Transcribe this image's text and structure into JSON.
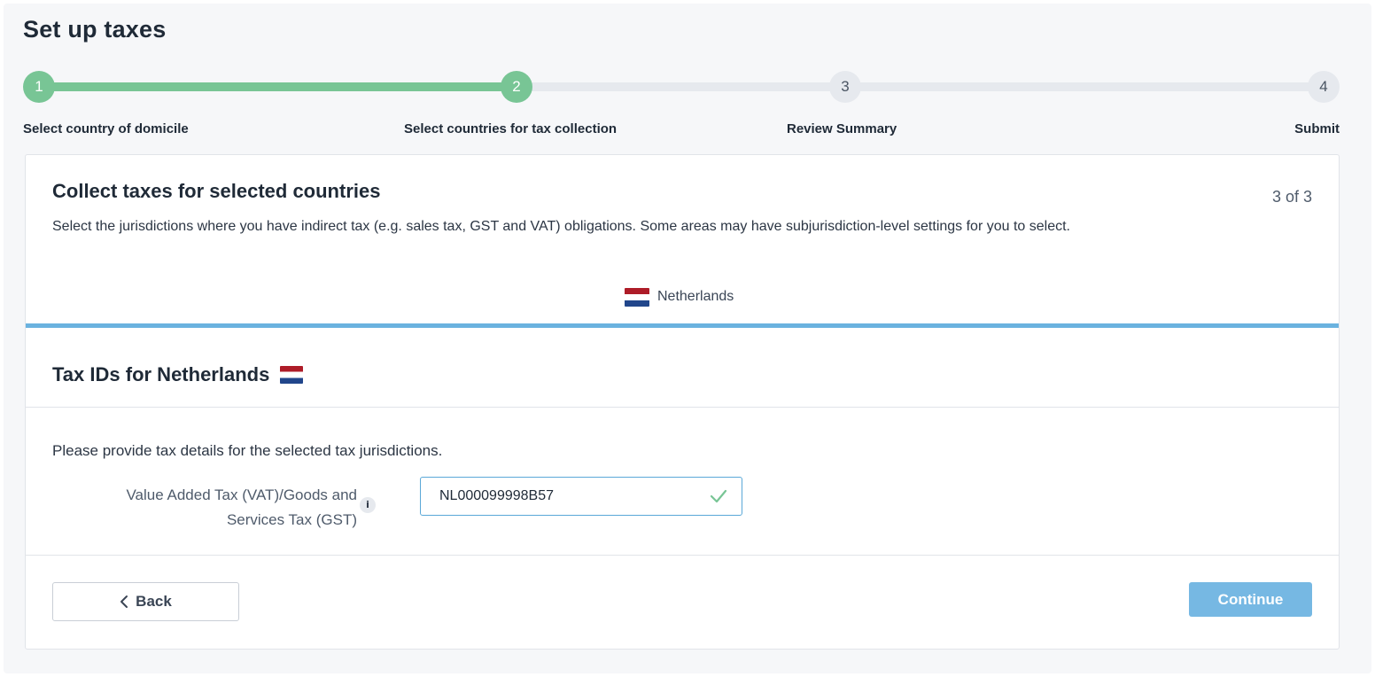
{
  "page": {
    "title": "Set up taxes"
  },
  "stepper": {
    "steps": [
      {
        "number": "1",
        "label": "Select country of domicile",
        "state": "done"
      },
      {
        "number": "2",
        "label": "Select countries for tax collection",
        "state": "done"
      },
      {
        "number": "3",
        "label": "Review Summary",
        "state": "pending"
      },
      {
        "number": "4",
        "label": "Submit",
        "state": "pending"
      }
    ],
    "colors": {
      "done": "#78c595",
      "pending": "#e6e9ee"
    }
  },
  "card": {
    "title": "Collect taxes for selected countries",
    "step_count": "3 of 3",
    "description": "Select the jurisdictions where you have indirect tax (e.g. sales tax, GST and VAT) obligations. Some areas may have subjurisdiction-level settings for you to select.",
    "country_tab": {
      "label": "Netherlands",
      "icon": "netherlands-flag-icon",
      "active_color": "#6ab2df"
    }
  },
  "tax_ids": {
    "title": "Tax IDs for Netherlands",
    "instructions": "Please provide tax details for the selected tax jurisdictions.",
    "field_label_line1": "Value Added Tax (VAT)/Goods and",
    "field_label_line2": "Services Tax (GST)",
    "info_icon_glyph": "i",
    "field_value": "NL000099998B57",
    "field_status": "valid",
    "valid_color": "#78c595"
  },
  "footer": {
    "back_label": "Back",
    "continue_label": "Continue",
    "continue_color": "#76b8e3"
  }
}
